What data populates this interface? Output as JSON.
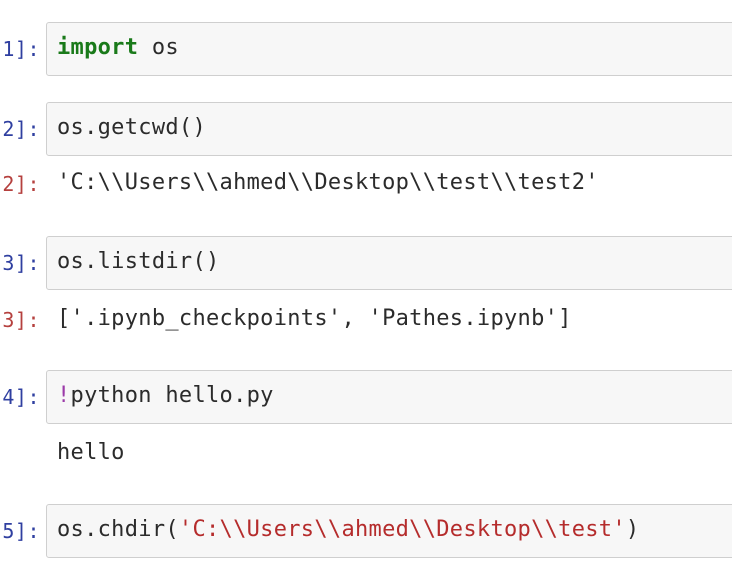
{
  "cells": [
    {
      "in_prompt": "1]:",
      "code_keyword": "import",
      "code_rest": " os"
    },
    {
      "in_prompt": "2]:",
      "code": "os.getcwd()",
      "out_prompt": "2]:",
      "output": "'C:\\\\Users\\\\ahmed\\\\Desktop\\\\test\\\\test2'"
    },
    {
      "in_prompt": "3]:",
      "code": "os.listdir()",
      "out_prompt": "3]:",
      "output": "['.ipynb_checkpoints', 'Pathes.ipynb']"
    },
    {
      "in_prompt": "4]:",
      "code_bang": "!",
      "code_rest": "python hello.py",
      "output": "hello"
    },
    {
      "in_prompt": "5]:",
      "code_pre": "os.chdir(",
      "code_string": "'C:\\\\Users\\\\ahmed\\\\Desktop\\\\test'",
      "code_post": ")"
    }
  ]
}
